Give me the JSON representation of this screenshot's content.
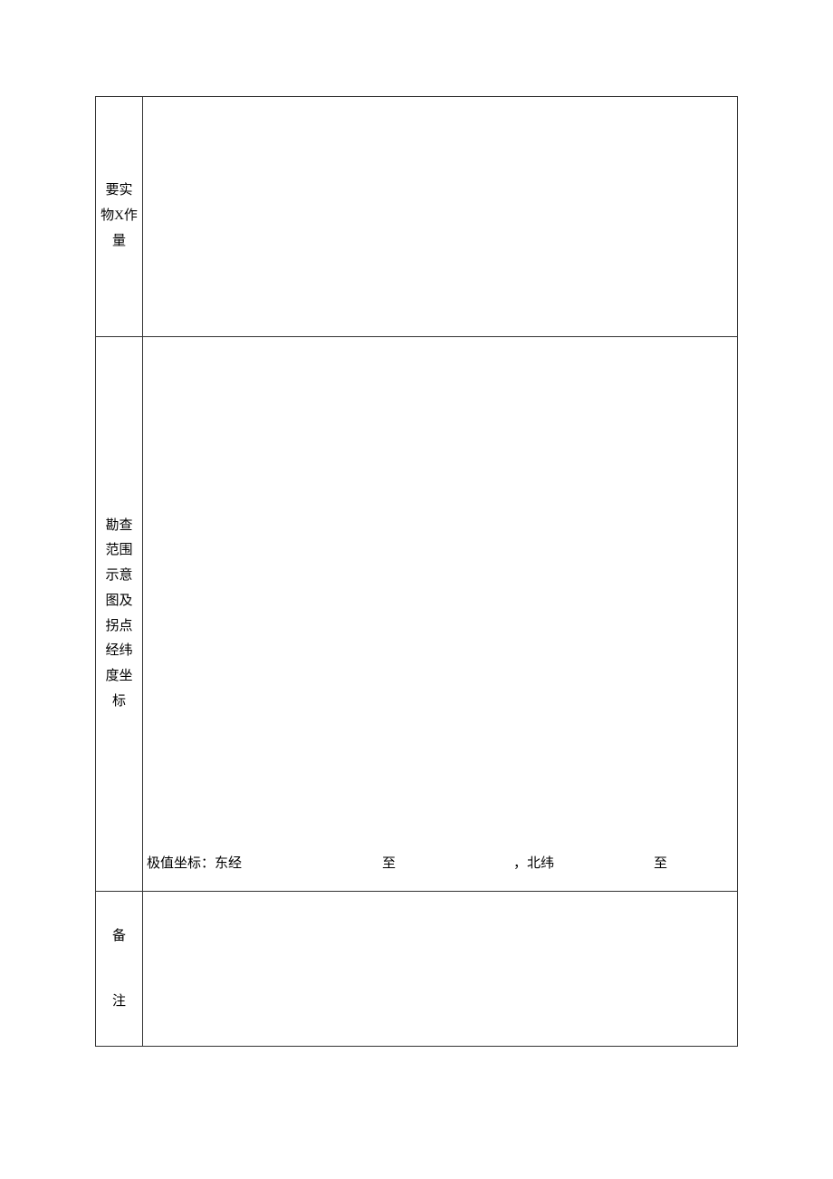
{
  "rows": {
    "workload": {
      "label": "要实物X作量",
      "content": ""
    },
    "survey_map": {
      "label": "勘查范围示意图及拐点经纬度坐标",
      "content": "",
      "coord_line": {
        "prefix": "极值坐标：东经",
        "to1": "至",
        "sep": "，北纬",
        "to2": "至"
      }
    },
    "remarks": {
      "label": "备注",
      "content": ""
    }
  }
}
